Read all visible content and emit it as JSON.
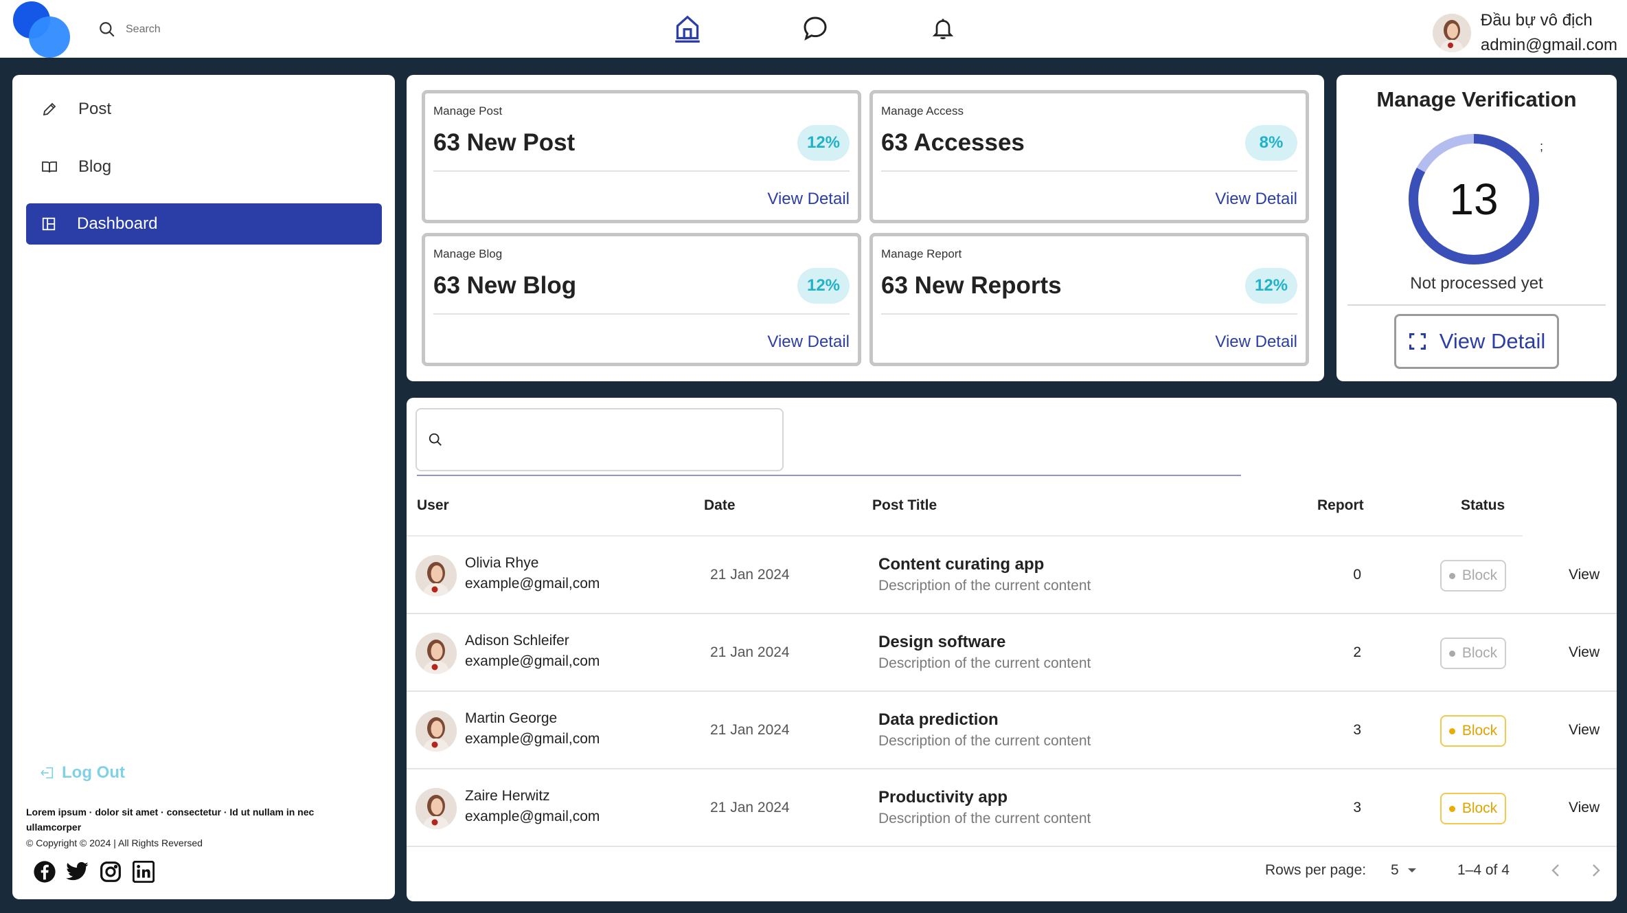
{
  "header": {
    "search_placeholder": "Search",
    "nav_icons": [
      "home-icon",
      "chat-icon",
      "bell-icon"
    ],
    "user_name": "Đầu bự vô địch",
    "user_email": "admin@gmail.com"
  },
  "sidebar": {
    "items": [
      {
        "label": "Post",
        "icon": "pencil-icon"
      },
      {
        "label": "Blog",
        "icon": "book-icon"
      },
      {
        "label": "Dashboard",
        "icon": "dashboard-icon",
        "active": true
      }
    ],
    "logout_label": "Log Out",
    "footer_text": "Lorem ipsum · dolor sit amet · consectetur · Id ut nullam in nec ullamcorper",
    "copyright": "© Copyright © 2024 | All Rights Reversed",
    "socials": [
      "facebook-icon",
      "twitter-icon",
      "instagram-icon",
      "linkedin-icon"
    ]
  },
  "cards": [
    {
      "label": "Manage Post",
      "value": "63 New Post",
      "badge": "12%",
      "link": "View Detail"
    },
    {
      "label": "Manage Access",
      "value": "63 Accesses",
      "badge": "8%",
      "link": "View Detail"
    },
    {
      "label": "Manage Blog",
      "value": "63 New Blog",
      "badge": "12%",
      "link": "View Detail"
    },
    {
      "label": "Manage Report",
      "value": "63 New Reports",
      "badge": "12%",
      "link": "View Detail"
    }
  ],
  "verification": {
    "title": "Manage Verification",
    "count": "13",
    "mark": ";",
    "progress": 0.83,
    "subtitle": "Not processed yet",
    "button_label": "View Detail"
  },
  "table": {
    "search_placeholder": "",
    "columns": [
      "User",
      "Date",
      "Post Title",
      "Report",
      "Status"
    ],
    "rows": [
      {
        "name": "Olivia Rhye",
        "email": "example@gmail,com",
        "date": "21 Jan 2024",
        "title": "Content curating app",
        "desc": "Description of the current content",
        "report": "0",
        "status": "Block",
        "status_type": "inactive",
        "action": "View"
      },
      {
        "name": "Adison Schleifer",
        "email": "example@gmail,com",
        "date": "21 Jan 2024",
        "title": "Design software",
        "desc": "Description of the current content",
        "report": "2",
        "status": "Block",
        "status_type": "inactive",
        "action": "View"
      },
      {
        "name": "Martin George",
        "email": "example@gmail,com",
        "date": "21 Jan 2024",
        "title": "Data prediction",
        "desc": "Description of the current content",
        "report": "3",
        "status": "Block",
        "status_type": "warning",
        "action": "View"
      },
      {
        "name": "Zaire Herwitz",
        "email": "example@gmail,com",
        "date": "21 Jan 2024",
        "title": "Productivity app",
        "desc": "Description of the current content",
        "report": "3",
        "status": "Block",
        "status_type": "warning",
        "action": "View"
      }
    ],
    "pagination": {
      "rows_per_page_label": "Rows per page:",
      "rows_per_page": "5",
      "range": "1–4 of 4"
    }
  },
  "colors": {
    "background": "#192a3b",
    "accent": "#2b3ea8",
    "badge_bg": "#d5f1f5",
    "badge_text": "#21b2c9",
    "warning": "#e0a400"
  }
}
